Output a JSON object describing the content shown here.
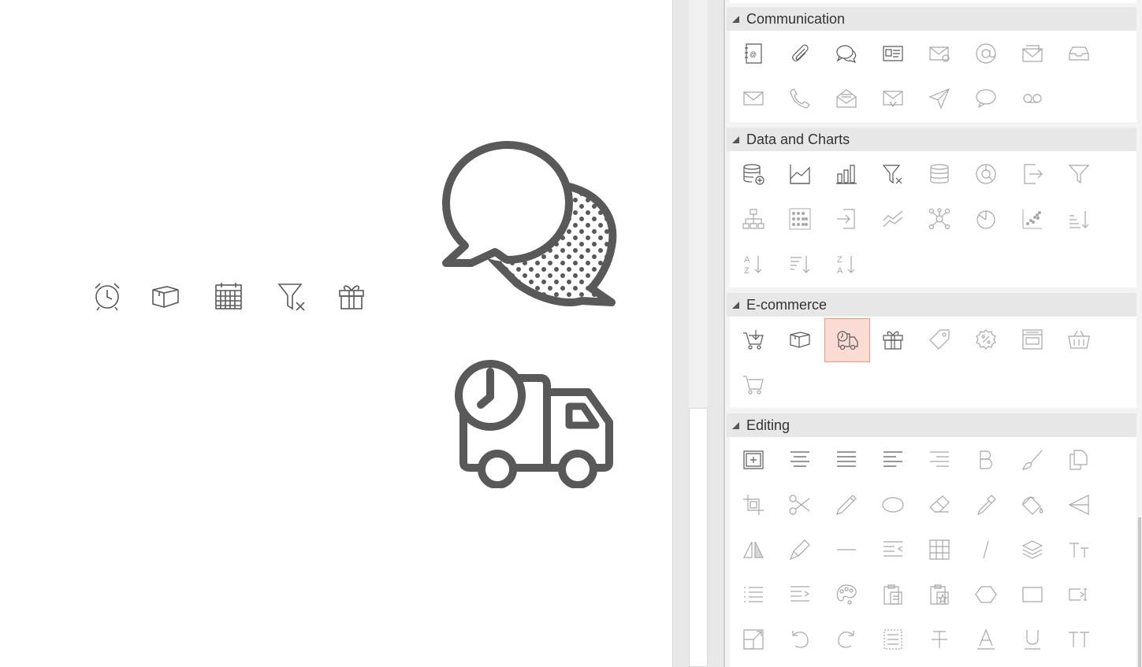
{
  "canvas": {
    "small_icons": [
      "alarm-clock-icon",
      "box-icon",
      "calendar-icon",
      "filter-clear-icon",
      "gift-icon"
    ],
    "large_icons": [
      "conversation-icon",
      "delivery-truck-clock-icon"
    ],
    "icon_color": "#595959"
  },
  "panel": {
    "sections": [
      {
        "name": "Communication",
        "rows": 2
      },
      {
        "name": "Data and Charts",
        "rows": 3
      },
      {
        "name": "E-commerce",
        "rows": 2
      },
      {
        "name": "Editing",
        "rows": 5
      }
    ],
    "selected_icon": "delivery-truck-clock-icon",
    "selected_color": "#fbdcd4"
  }
}
